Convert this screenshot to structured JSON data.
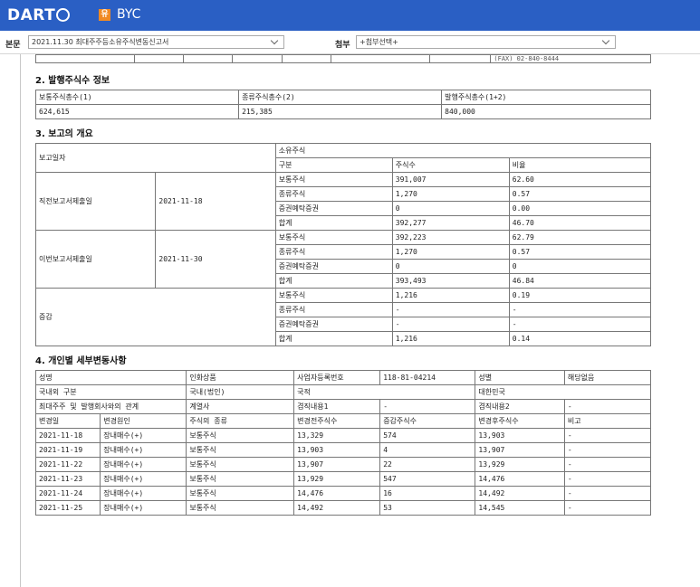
{
  "header": {
    "logo_text": "DART",
    "corp_badge": "유",
    "corp_name": "BYC"
  },
  "selectors": {
    "main_label": "본문",
    "main_value": "2021.11.30  최대주주등소유주식변동신고서",
    "attach_label": "첨부",
    "attach_value": "+첨부선택+"
  },
  "top_stub": {
    "phone": "(FAX) 02-840-8444"
  },
  "section2": {
    "title": "2. 발행주식수 정보",
    "headers": [
      "보통주식총수(1)",
      "종류주식총수(2)",
      "발행주식총수(1+2)"
    ],
    "values": [
      "624,615",
      "215,385",
      "840,000"
    ]
  },
  "section3": {
    "title": "3. 보고의 개요",
    "report_date_label": "보고일자",
    "owned_shares_label": "소유주식",
    "col_headers": [
      "구분",
      "주식수",
      "비율"
    ],
    "groups": [
      {
        "label": "직전보고서제출일",
        "date": "2021-11-18",
        "rows": [
          [
            "보통주식",
            "391,007",
            "62.60"
          ],
          [
            "종류주식",
            "1,270",
            "0.57"
          ],
          [
            "증권예탁증권",
            "0",
            "0.00"
          ],
          [
            "합계",
            "392,277",
            "46.70"
          ]
        ]
      },
      {
        "label": "이번보고서제출일",
        "date": "2021-11-30",
        "rows": [
          [
            "보통주식",
            "392,223",
            "62.79"
          ],
          [
            "종류주식",
            "1,270",
            "0.57"
          ],
          [
            "증권예탁증권",
            "0",
            "0"
          ],
          [
            "합계",
            "393,493",
            "46.84"
          ]
        ]
      },
      {
        "label": "증감",
        "date": "",
        "rows": [
          [
            "보통주식",
            "1,216",
            "0.19"
          ],
          [
            "종류주식",
            "-",
            "-"
          ],
          [
            "증권예탁증권",
            "-",
            "-"
          ],
          [
            "합계",
            "1,216",
            "0.14"
          ]
        ]
      }
    ]
  },
  "section4": {
    "title": "4. 개인별 세부변동사항",
    "info_rows": [
      [
        "성명",
        "",
        "인화상품",
        "사업자등록번호",
        "118-81-04214",
        "성별",
        "해당없음"
      ],
      [
        "국내외 구분",
        "",
        "국내(법인)",
        "국적",
        "",
        "대한민국",
        ""
      ],
      [
        "최대주주 및 발행회사와의 관계",
        "",
        "계열사",
        "겸직내용1",
        "-",
        "겸직내용2",
        "-"
      ]
    ],
    "change_headers": [
      "변경일",
      "변경원인",
      "주식의 종류",
      "변경전주식수",
      "증감주식수",
      "변경후주식수",
      "비고"
    ],
    "change_rows": [
      [
        "2021-11-18",
        "장내매수(+)",
        "보통주식",
        "13,329",
        "574",
        "13,903",
        "-"
      ],
      [
        "2021-11-19",
        "장내매수(+)",
        "보통주식",
        "13,903",
        "4",
        "13,907",
        "-"
      ],
      [
        "2021-11-22",
        "장내매수(+)",
        "보통주식",
        "13,907",
        "22",
        "13,929",
        "-"
      ],
      [
        "2021-11-23",
        "장내매수(+)",
        "보통주식",
        "13,929",
        "547",
        "14,476",
        "-"
      ],
      [
        "2021-11-24",
        "장내매수(+)",
        "보통주식",
        "14,476",
        "16",
        "14,492",
        "-"
      ],
      [
        "2021-11-25",
        "장내매수(+)",
        "보통주식",
        "14,492",
        "53",
        "14,545",
        "-"
      ]
    ]
  }
}
